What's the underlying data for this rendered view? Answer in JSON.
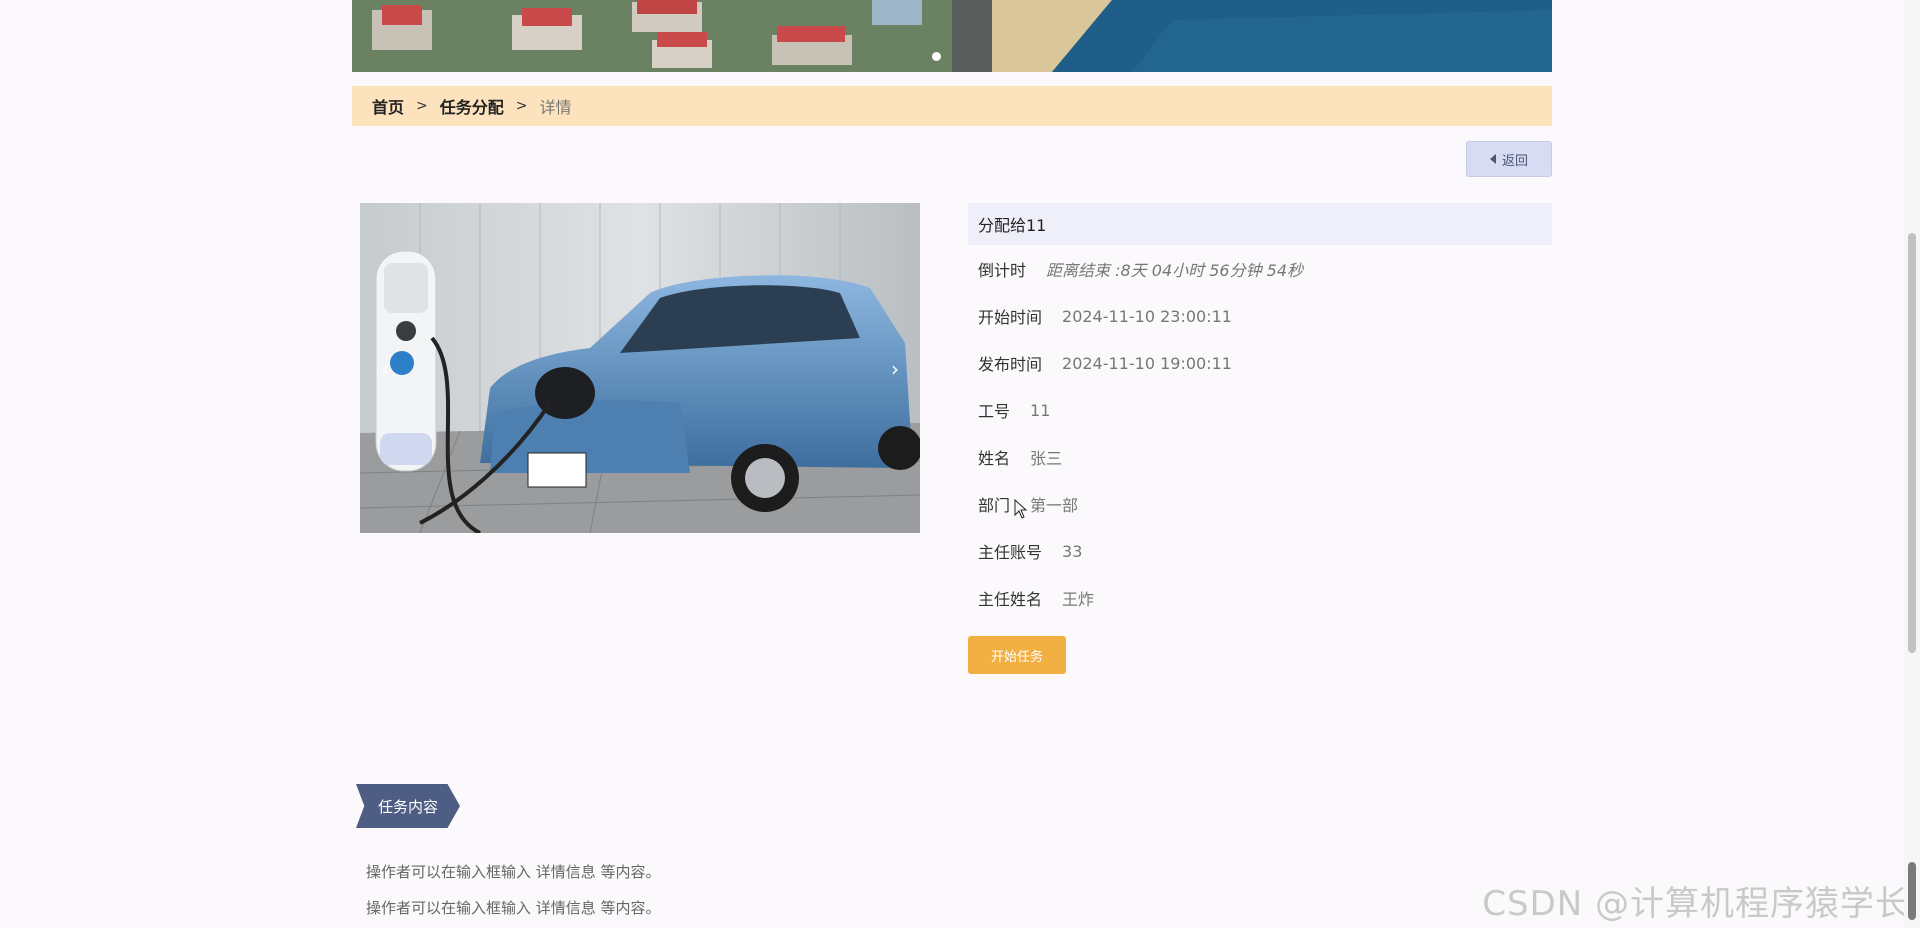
{
  "breadcrumb": {
    "home": "首页",
    "parent": "任务分配",
    "current": "详情",
    "separator": ">"
  },
  "back_button": {
    "label": "返回"
  },
  "detail": {
    "title": "分配给11",
    "countdown": {
      "label": "倒计时",
      "value": "距离结束 :8天 04小时 56分钟 54秒"
    },
    "rows": [
      {
        "label": "开始时间",
        "value": "2024-11-10 23:00:11"
      },
      {
        "label": "发布时间",
        "value": "2024-11-10 19:00:11"
      },
      {
        "label": "工号",
        "value": "11"
      },
      {
        "label": "姓名",
        "value": "张三"
      },
      {
        "label": "部门",
        "value": "第一部"
      },
      {
        "label": "主任账号",
        "value": "33"
      },
      {
        "label": "主任姓名",
        "value": "王炸"
      }
    ]
  },
  "start_button": {
    "label": "开始任务"
  },
  "carousel": {
    "prev": "‹",
    "next": "›"
  },
  "section": {
    "title": "任务内容",
    "lines": [
      "操作者可以在输入框输入 详情信息 等内容。",
      "操作者可以在输入框输入 详情信息 等内容。"
    ]
  },
  "watermark": "CSDN @计算机程序猿学长",
  "colors": {
    "breadcrumb_bg": "#fde3bd",
    "start_button": "#f3b042",
    "section_tag": "#4e5d83",
    "back_button": "#d7dcf3"
  }
}
